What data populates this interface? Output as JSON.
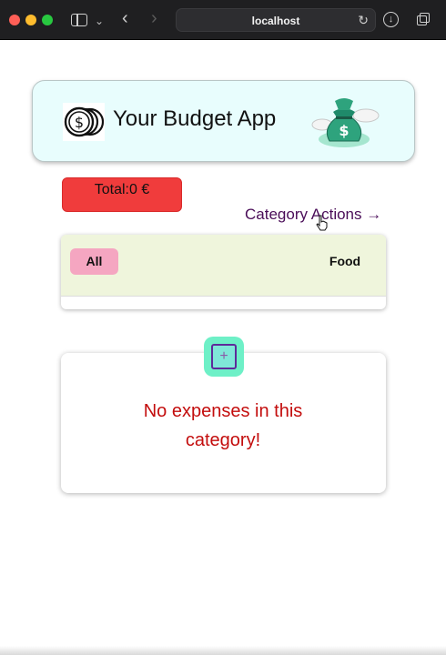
{
  "browser": {
    "address": "localhost",
    "icons": [
      "sidebar-icon",
      "chevron-down-icon",
      "back-arrow-icon",
      "forward-arrow-icon",
      "reload-icon",
      "download-icon",
      "tabs-overview-icon"
    ]
  },
  "header": {
    "title": "Your Budget App",
    "left_logo": "coins-icon",
    "right_logo": "money-bag-icon"
  },
  "total": {
    "label": "Total:0 €"
  },
  "category_actions": {
    "label": "Category Actions →"
  },
  "categories": {
    "tabs": [
      {
        "label": "All",
        "selected": true
      },
      {
        "label": "Food",
        "selected": false
      }
    ]
  },
  "expenses": {
    "empty_message": "No expenses in this category!",
    "add_icon": "plus-icon"
  },
  "colors": {
    "header_bg": "#e8fdfd",
    "total_bg": "#f03c3c",
    "tabs_bg": "#eff5dc",
    "selected_tab": "#f5a6c1",
    "add_button": "#6ef0c7",
    "empty_text": "#c30d0d",
    "link_text": "#4a0d58"
  }
}
